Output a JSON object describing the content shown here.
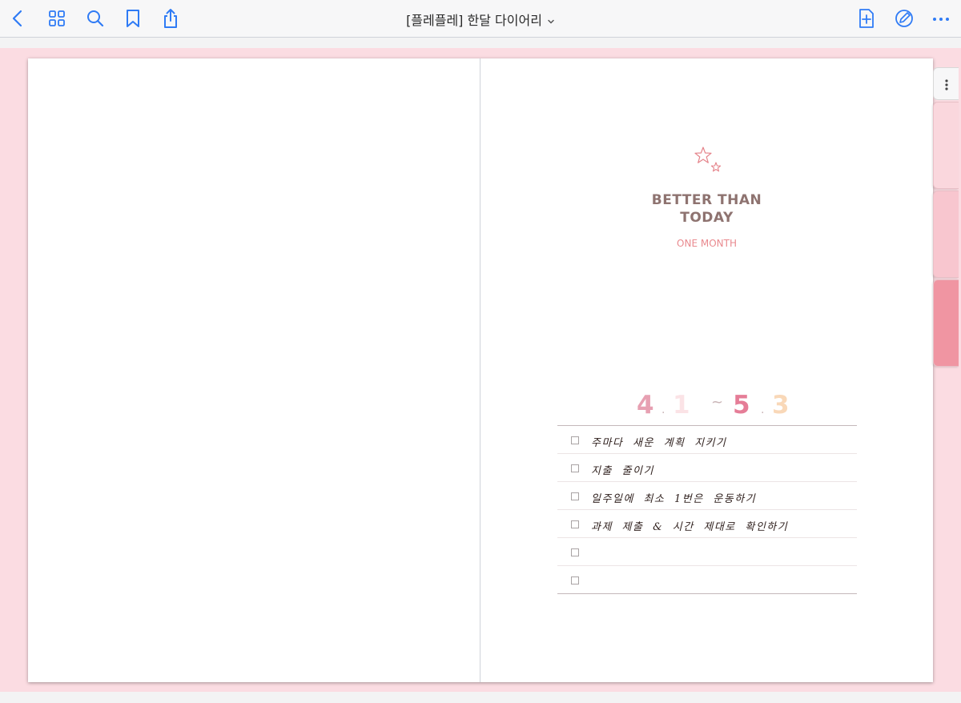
{
  "toolbar": {
    "back_icon": "chevron-left-icon",
    "grid_icon": "grid-icon",
    "search_icon": "search-icon",
    "bookmark_icon": "bookmark-icon",
    "share_icon": "share-icon",
    "title": "[플레플레] 한달 다이어리",
    "add_page_icon": "add-page-icon",
    "pen_icon": "pen-icon",
    "more_icon": "more-icon",
    "accent_color": "#2f7bf5"
  },
  "page": {
    "headline_line1": "BETTER THAN",
    "headline_line2": "TODAY",
    "subhead": "ONE MONTH",
    "date_range": {
      "start_month": "4",
      "start_day": "1",
      "separator_dot": ".",
      "tilde": "~",
      "end_month": "5",
      "end_day": "3",
      "colors": {
        "start_month": "#e7a0b2",
        "start_day": "#fbe3e6",
        "end_month": "#e57d97",
        "end_day": "#f9d8b8"
      }
    },
    "goals": [
      {
        "text": "주마다 새운 계획 지키기"
      },
      {
        "text": "지출 줄이기"
      },
      {
        "text": "일주일에 최소 1번은 운동하기"
      },
      {
        "text": "과제 제출 & 시간 제대로 확인하기"
      },
      {
        "text": ""
      },
      {
        "text": ""
      }
    ]
  },
  "side_tabs": {
    "menu_icon": "vertical-ellipsis-icon",
    "tabs": [
      {
        "color": "#fad7dd"
      },
      {
        "color": "#f8c6cf"
      },
      {
        "color": "#f095a2"
      }
    ]
  }
}
